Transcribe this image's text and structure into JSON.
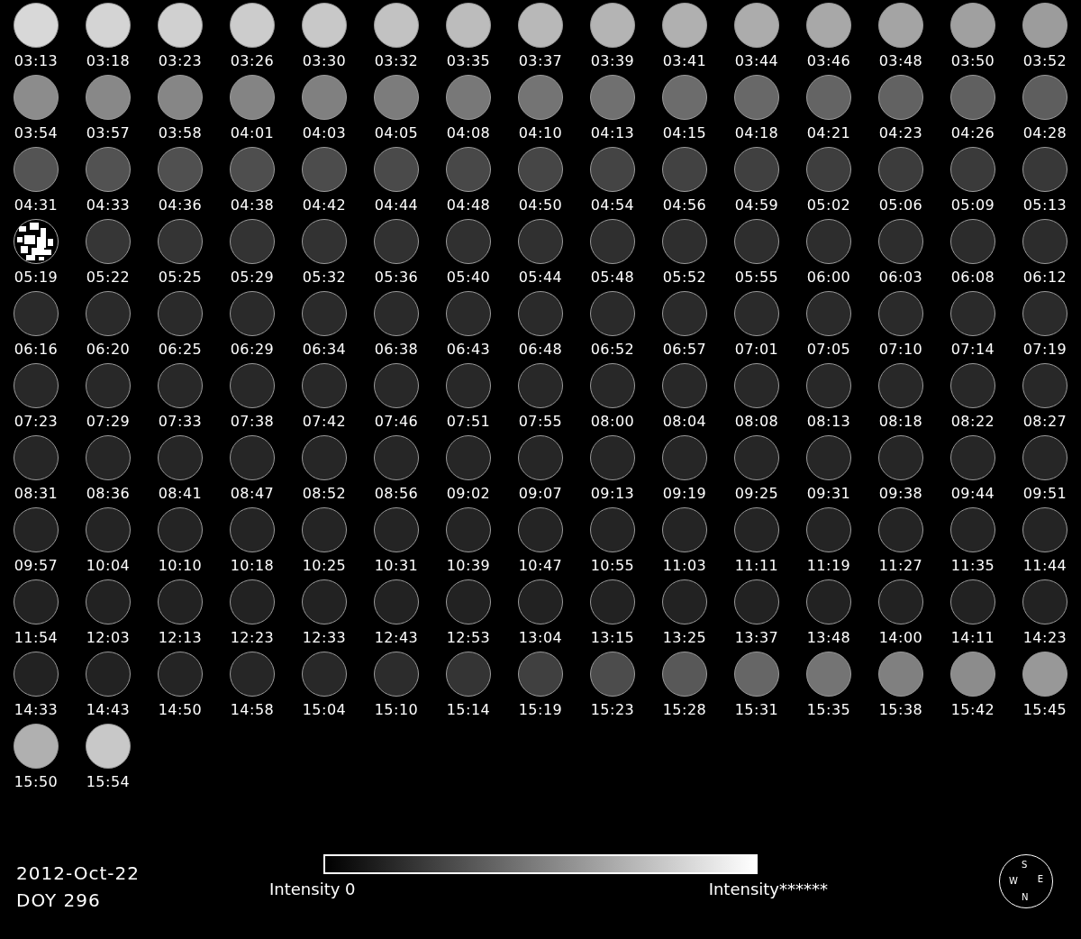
{
  "frames": [
    {
      "time": "03:13",
      "color": "#d8d8d8",
      "kind": "disc"
    },
    {
      "time": "03:18",
      "color": "#d4d4d4",
      "kind": "disc"
    },
    {
      "time": "03:23",
      "color": "#d0d0d0",
      "kind": "disc"
    },
    {
      "time": "03:26",
      "color": "#cccccc",
      "kind": "disc"
    },
    {
      "time": "03:30",
      "color": "#c8c8c8",
      "kind": "disc"
    },
    {
      "time": "03:32",
      "color": "#c2c2c2",
      "kind": "disc"
    },
    {
      "time": "03:35",
      "color": "#bcbcbc",
      "kind": "disc"
    },
    {
      "time": "03:37",
      "color": "#b8b8b8",
      "kind": "disc"
    },
    {
      "time": "03:39",
      "color": "#b4b4b4",
      "kind": "disc"
    },
    {
      "time": "03:41",
      "color": "#b0b0b0",
      "kind": "disc"
    },
    {
      "time": "03:44",
      "color": "#acacac",
      "kind": "disc"
    },
    {
      "time": "03:46",
      "color": "#a8a8a8",
      "kind": "disc"
    },
    {
      "time": "03:48",
      "color": "#a4a4a4",
      "kind": "disc"
    },
    {
      "time": "03:50",
      "color": "#a0a0a0",
      "kind": "disc"
    },
    {
      "time": "03:52",
      "color": "#9c9c9c",
      "kind": "disc"
    },
    {
      "time": "03:54",
      "color": "#8c8c8c",
      "kind": "disc"
    },
    {
      "time": "03:57",
      "color": "#888888",
      "kind": "disc"
    },
    {
      "time": "03:58",
      "color": "#868686",
      "kind": "disc"
    },
    {
      "time": "04:01",
      "color": "#848484",
      "kind": "disc"
    },
    {
      "time": "04:03",
      "color": "#808080",
      "kind": "disc"
    },
    {
      "time": "04:05",
      "color": "#7c7c7c",
      "kind": "disc"
    },
    {
      "time": "04:08",
      "color": "#787878",
      "kind": "disc"
    },
    {
      "time": "04:10",
      "color": "#747474",
      "kind": "disc"
    },
    {
      "time": "04:13",
      "color": "#707070",
      "kind": "disc"
    },
    {
      "time": "04:15",
      "color": "#6c6c6c",
      "kind": "disc"
    },
    {
      "time": "04:18",
      "color": "#686868",
      "kind": "disc"
    },
    {
      "time": "04:21",
      "color": "#646464",
      "kind": "disc"
    },
    {
      "time": "04:23",
      "color": "#626262",
      "kind": "disc"
    },
    {
      "time": "04:26",
      "color": "#606060",
      "kind": "disc"
    },
    {
      "time": "04:28",
      "color": "#5e5e5e",
      "kind": "disc"
    },
    {
      "time": "04:31",
      "color": "#545454",
      "kind": "disc"
    },
    {
      "time": "04:33",
      "color": "#525252",
      "kind": "disc"
    },
    {
      "time": "04:36",
      "color": "#505050",
      "kind": "disc"
    },
    {
      "time": "04:38",
      "color": "#4e4e4e",
      "kind": "disc"
    },
    {
      "time": "04:42",
      "color": "#4c4c4c",
      "kind": "disc"
    },
    {
      "time": "04:44",
      "color": "#4a4a4a",
      "kind": "disc"
    },
    {
      "time": "04:48",
      "color": "#484848",
      "kind": "disc"
    },
    {
      "time": "04:50",
      "color": "#464646",
      "kind": "disc"
    },
    {
      "time": "04:54",
      "color": "#444444",
      "kind": "disc"
    },
    {
      "time": "04:56",
      "color": "#424242",
      "kind": "disc"
    },
    {
      "time": "04:59",
      "color": "#404040",
      "kind": "disc"
    },
    {
      "time": "05:02",
      "color": "#3e3e3e",
      "kind": "disc"
    },
    {
      "time": "05:06",
      "color": "#3c3c3c",
      "kind": "disc"
    },
    {
      "time": "05:09",
      "color": "#3a3a3a",
      "kind": "disc"
    },
    {
      "time": "05:13",
      "color": "#383838",
      "kind": "disc"
    },
    {
      "time": "05:19",
      "color": "#ffffff",
      "kind": "noise"
    },
    {
      "time": "05:22",
      "color": "#363636",
      "kind": "disc"
    },
    {
      "time": "05:25",
      "color": "#343434",
      "kind": "disc"
    },
    {
      "time": "05:29",
      "color": "#333333",
      "kind": "disc"
    },
    {
      "time": "05:32",
      "color": "#323232",
      "kind": "disc"
    },
    {
      "time": "05:36",
      "color": "#313131",
      "kind": "disc"
    },
    {
      "time": "05:40",
      "color": "#303030",
      "kind": "disc"
    },
    {
      "time": "05:44",
      "color": "#303030",
      "kind": "disc"
    },
    {
      "time": "05:48",
      "color": "#2f2f2f",
      "kind": "disc"
    },
    {
      "time": "05:52",
      "color": "#2e2e2e",
      "kind": "disc"
    },
    {
      "time": "05:55",
      "color": "#2e2e2e",
      "kind": "disc"
    },
    {
      "time": "06:00",
      "color": "#2d2d2d",
      "kind": "disc"
    },
    {
      "time": "06:03",
      "color": "#2d2d2d",
      "kind": "disc"
    },
    {
      "time": "06:08",
      "color": "#2c2c2c",
      "kind": "disc"
    },
    {
      "time": "06:12",
      "color": "#2c2c2c",
      "kind": "disc"
    },
    {
      "time": "06:16",
      "color": "#2a2a2a",
      "kind": "disc"
    },
    {
      "time": "06:20",
      "color": "#2a2a2a",
      "kind": "disc"
    },
    {
      "time": "06:25",
      "color": "#2a2a2a",
      "kind": "disc"
    },
    {
      "time": "06:29",
      "color": "#2a2a2a",
      "kind": "disc"
    },
    {
      "time": "06:34",
      "color": "#2a2a2a",
      "kind": "disc"
    },
    {
      "time": "06:38",
      "color": "#2a2a2a",
      "kind": "disc"
    },
    {
      "time": "06:43",
      "color": "#2a2a2a",
      "kind": "disc"
    },
    {
      "time": "06:48",
      "color": "#2a2a2a",
      "kind": "disc"
    },
    {
      "time": "06:52",
      "color": "#2a2a2a",
      "kind": "disc"
    },
    {
      "time": "06:57",
      "color": "#2a2a2a",
      "kind": "disc"
    },
    {
      "time": "07:01",
      "color": "#2a2a2a",
      "kind": "disc"
    },
    {
      "time": "07:05",
      "color": "#2a2a2a",
      "kind": "disc"
    },
    {
      "time": "07:10",
      "color": "#2a2a2a",
      "kind": "disc"
    },
    {
      "time": "07:14",
      "color": "#2a2a2a",
      "kind": "disc"
    },
    {
      "time": "07:19",
      "color": "#2a2a2a",
      "kind": "disc"
    },
    {
      "time": "07:23",
      "color": "#282828",
      "kind": "disc"
    },
    {
      "time": "07:29",
      "color": "#282828",
      "kind": "disc"
    },
    {
      "time": "07:33",
      "color": "#282828",
      "kind": "disc"
    },
    {
      "time": "07:38",
      "color": "#282828",
      "kind": "disc"
    },
    {
      "time": "07:42",
      "color": "#282828",
      "kind": "disc"
    },
    {
      "time": "07:46",
      "color": "#282828",
      "kind": "disc"
    },
    {
      "time": "07:51",
      "color": "#282828",
      "kind": "disc"
    },
    {
      "time": "07:55",
      "color": "#282828",
      "kind": "disc"
    },
    {
      "time": "08:00",
      "color": "#282828",
      "kind": "disc"
    },
    {
      "time": "08:04",
      "color": "#282828",
      "kind": "disc"
    },
    {
      "time": "08:08",
      "color": "#282828",
      "kind": "disc"
    },
    {
      "time": "08:13",
      "color": "#282828",
      "kind": "disc"
    },
    {
      "time": "08:18",
      "color": "#282828",
      "kind": "disc"
    },
    {
      "time": "08:22",
      "color": "#282828",
      "kind": "disc"
    },
    {
      "time": "08:27",
      "color": "#282828",
      "kind": "disc"
    },
    {
      "time": "08:31",
      "color": "#262626",
      "kind": "disc"
    },
    {
      "time": "08:36",
      "color": "#262626",
      "kind": "disc"
    },
    {
      "time": "08:41",
      "color": "#262626",
      "kind": "disc"
    },
    {
      "time": "08:47",
      "color": "#262626",
      "kind": "disc"
    },
    {
      "time": "08:52",
      "color": "#262626",
      "kind": "disc"
    },
    {
      "time": "08:56",
      "color": "#262626",
      "kind": "disc"
    },
    {
      "time": "09:02",
      "color": "#262626",
      "kind": "disc"
    },
    {
      "time": "09:07",
      "color": "#262626",
      "kind": "disc"
    },
    {
      "time": "09:13",
      "color": "#262626",
      "kind": "disc"
    },
    {
      "time": "09:19",
      "color": "#262626",
      "kind": "disc"
    },
    {
      "time": "09:25",
      "color": "#262626",
      "kind": "disc"
    },
    {
      "time": "09:31",
      "color": "#262626",
      "kind": "disc"
    },
    {
      "time": "09:38",
      "color": "#262626",
      "kind": "disc"
    },
    {
      "time": "09:44",
      "color": "#262626",
      "kind": "disc"
    },
    {
      "time": "09:51",
      "color": "#262626",
      "kind": "disc"
    },
    {
      "time": "09:57",
      "color": "#242424",
      "kind": "disc"
    },
    {
      "time": "10:04",
      "color": "#242424",
      "kind": "disc"
    },
    {
      "time": "10:10",
      "color": "#242424",
      "kind": "disc"
    },
    {
      "time": "10:18",
      "color": "#242424",
      "kind": "disc"
    },
    {
      "time": "10:25",
      "color": "#242424",
      "kind": "disc"
    },
    {
      "time": "10:31",
      "color": "#242424",
      "kind": "disc"
    },
    {
      "time": "10:39",
      "color": "#242424",
      "kind": "disc"
    },
    {
      "time": "10:47",
      "color": "#242424",
      "kind": "disc"
    },
    {
      "time": "10:55",
      "color": "#242424",
      "kind": "disc"
    },
    {
      "time": "11:03",
      "color": "#242424",
      "kind": "disc"
    },
    {
      "time": "11:11",
      "color": "#242424",
      "kind": "disc"
    },
    {
      "time": "11:19",
      "color": "#242424",
      "kind": "disc"
    },
    {
      "time": "11:27",
      "color": "#242424",
      "kind": "disc"
    },
    {
      "time": "11:35",
      "color": "#242424",
      "kind": "disc"
    },
    {
      "time": "11:44",
      "color": "#242424",
      "kind": "disc"
    },
    {
      "time": "11:54",
      "color": "#222222",
      "kind": "disc"
    },
    {
      "time": "12:03",
      "color": "#222222",
      "kind": "disc"
    },
    {
      "time": "12:13",
      "color": "#222222",
      "kind": "disc"
    },
    {
      "time": "12:23",
      "color": "#222222",
      "kind": "disc"
    },
    {
      "time": "12:33",
      "color": "#222222",
      "kind": "disc"
    },
    {
      "time": "12:43",
      "color": "#222222",
      "kind": "disc"
    },
    {
      "time": "12:53",
      "color": "#222222",
      "kind": "disc"
    },
    {
      "time": "13:04",
      "color": "#222222",
      "kind": "disc"
    },
    {
      "time": "13:15",
      "color": "#222222",
      "kind": "disc"
    },
    {
      "time": "13:25",
      "color": "#222222",
      "kind": "disc"
    },
    {
      "time": "13:37",
      "color": "#222222",
      "kind": "disc"
    },
    {
      "time": "13:48",
      "color": "#222222",
      "kind": "disc"
    },
    {
      "time": "14:00",
      "color": "#222222",
      "kind": "disc"
    },
    {
      "time": "14:11",
      "color": "#222222",
      "kind": "disc"
    },
    {
      "time": "14:23",
      "color": "#222222",
      "kind": "disc"
    },
    {
      "time": "14:33",
      "color": "#222222",
      "kind": "disc"
    },
    {
      "time": "14:43",
      "color": "#222222",
      "kind": "disc"
    },
    {
      "time": "14:50",
      "color": "#242424",
      "kind": "disc"
    },
    {
      "time": "14:58",
      "color": "#262626",
      "kind": "disc"
    },
    {
      "time": "15:04",
      "color": "#282828",
      "kind": "disc"
    },
    {
      "time": "15:10",
      "color": "#2c2c2c",
      "kind": "disc"
    },
    {
      "time": "15:14",
      "color": "#343434",
      "kind": "disc"
    },
    {
      "time": "15:19",
      "color": "#404040",
      "kind": "disc"
    },
    {
      "time": "15:23",
      "color": "#4c4c4c",
      "kind": "disc"
    },
    {
      "time": "15:28",
      "color": "#585858",
      "kind": "disc"
    },
    {
      "time": "15:31",
      "color": "#666666",
      "kind": "disc"
    },
    {
      "time": "15:35",
      "color": "#747474",
      "kind": "disc"
    },
    {
      "time": "15:38",
      "color": "#808080",
      "kind": "disc"
    },
    {
      "time": "15:42",
      "color": "#8c8c8c",
      "kind": "disc"
    },
    {
      "time": "15:45",
      "color": "#989898",
      "kind": "disc"
    },
    {
      "time": "15:50",
      "color": "#b0b0b0",
      "kind": "disc"
    },
    {
      "time": "15:54",
      "color": "#c8c8c8",
      "kind": "disc"
    }
  ],
  "date": "2012-Oct-22",
  "doy": "DOY 296",
  "colorbar": {
    "min_label": "Intensity 0",
    "max_label": "Intensity******"
  },
  "compass": {
    "top": "S",
    "left": "W",
    "right": "E",
    "bottom": "N"
  }
}
